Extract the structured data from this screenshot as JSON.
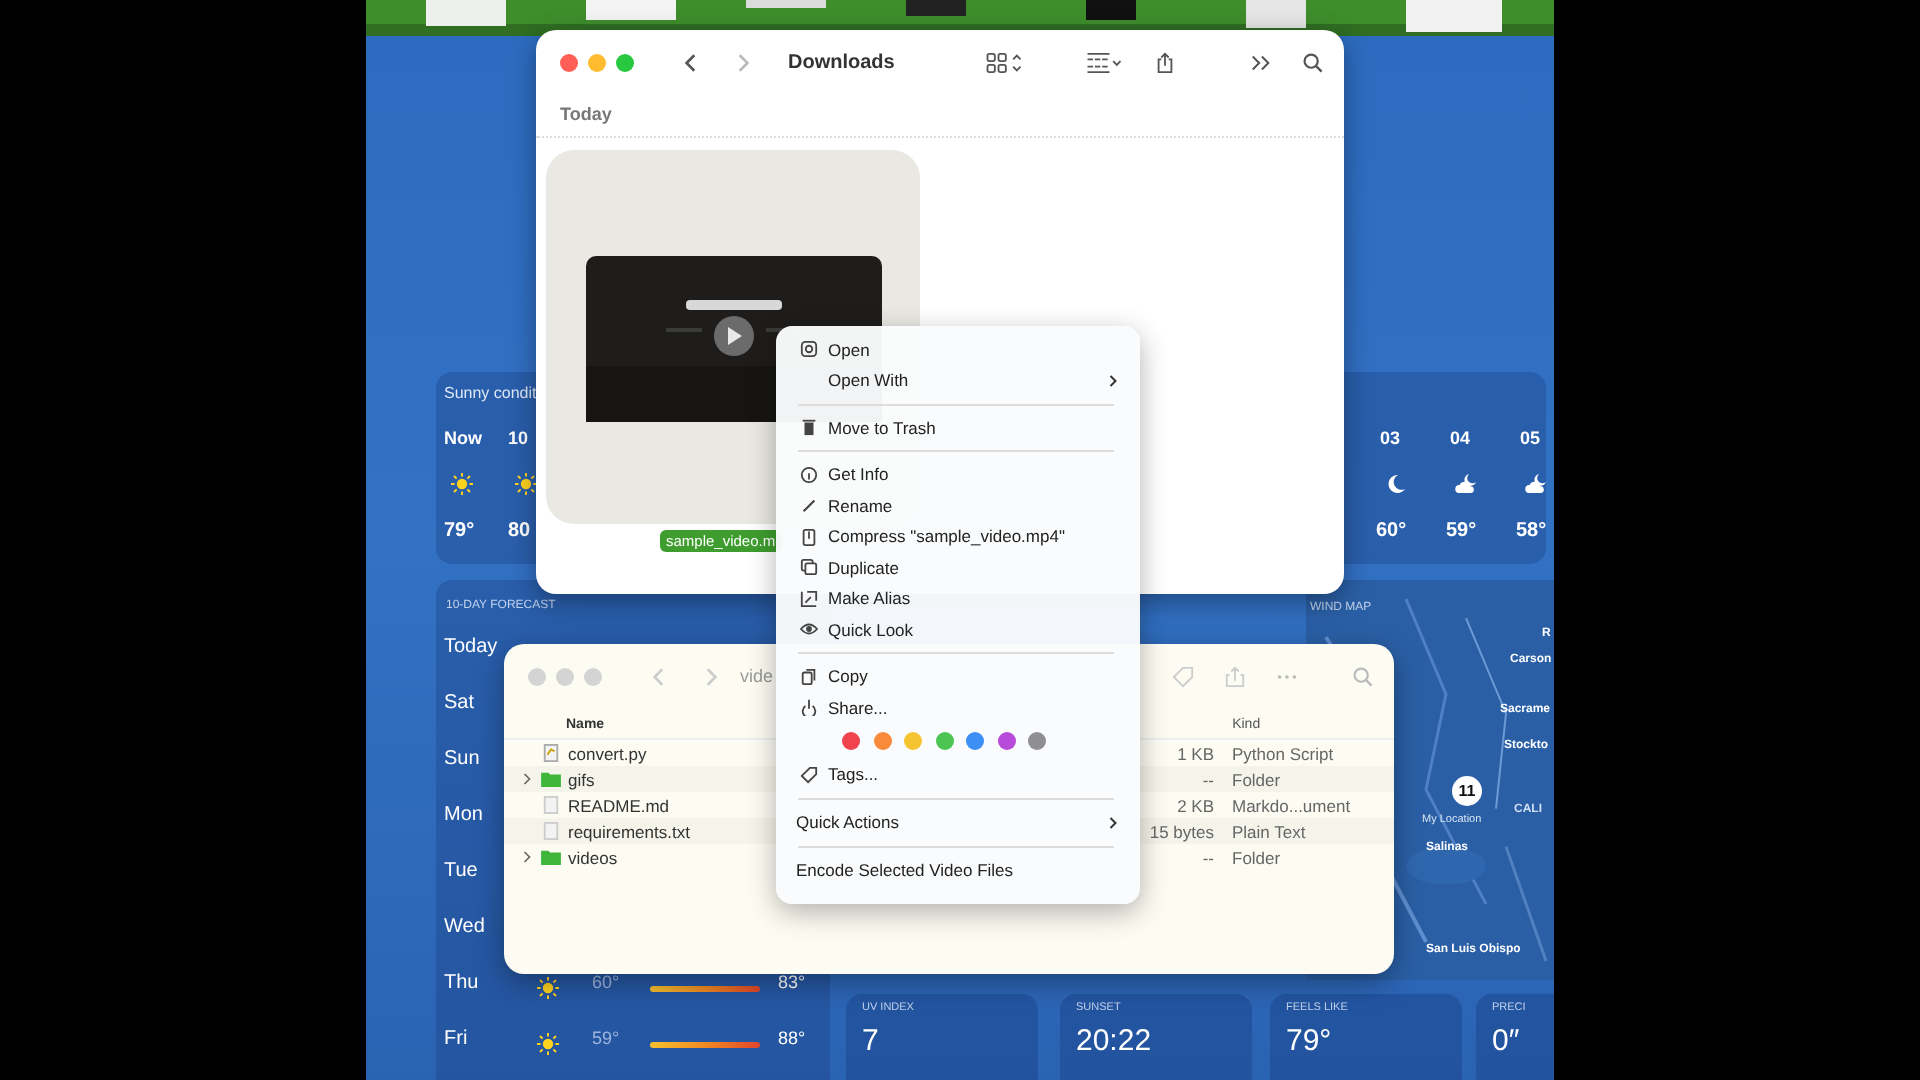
{
  "weather": {
    "summary": "Sunny condit",
    "hourly": [
      {
        "time": "Now",
        "kind": "sun",
        "temp": "79°"
      },
      {
        "time": "10",
        "kind": "sun",
        "temp": "80"
      }
    ],
    "hourly_late": [
      {
        "time": "03",
        "kind": "moon",
        "temp": "60°"
      },
      {
        "time": "04",
        "kind": "cloud-moon",
        "temp": "59°"
      },
      {
        "time": "05",
        "kind": "cloud-moon",
        "temp": "58°"
      }
    ],
    "forecast_title": "10-DAY FORECAST",
    "days": [
      {
        "day": "Today"
      },
      {
        "day": "Sat"
      },
      {
        "day": "Sun"
      },
      {
        "day": "Mon"
      },
      {
        "day": "Tue"
      },
      {
        "day": "Wed"
      },
      {
        "day": "Thu",
        "low": "60°",
        "high": "83°"
      },
      {
        "day": "Fri",
        "low": "59°",
        "high": "88°"
      }
    ],
    "map": {
      "title": "WIND MAP",
      "badge": "11",
      "badge_label": "My Location",
      "places": [
        {
          "name": "R",
          "kind": "edge"
        },
        {
          "name": "Carson",
          "kind": "city"
        },
        {
          "name": "Sacrame",
          "kind": "city"
        },
        {
          "name": "Stockto",
          "kind": "city"
        },
        {
          "name": "CALI",
          "kind": "region"
        },
        {
          "name": "Salinas",
          "kind": "city"
        },
        {
          "name": "San Luis Obispo",
          "kind": "city"
        }
      ]
    },
    "tiles": [
      {
        "kind": "uv",
        "label": "UV INDEX",
        "value": "7"
      },
      {
        "kind": "sunset",
        "label": "SUNSET",
        "value": "20:22"
      },
      {
        "kind": "feels",
        "label": "FEELS LIKE",
        "value": "79°"
      },
      {
        "kind": "precip",
        "label": "PRECI",
        "value": "0″"
      }
    ]
  },
  "downloads": {
    "title": "Downloads",
    "active": true,
    "section": "Today",
    "file": {
      "name": "sample_video.m",
      "selected": true
    }
  },
  "context_menu": [
    {
      "kind": "open",
      "label": "Open"
    },
    {
      "kind": "open-with",
      "label": "Open With"
    },
    {
      "kind": "separator"
    },
    {
      "kind": "trash",
      "label": "Move to Trash"
    },
    {
      "kind": "separator"
    },
    {
      "kind": "info",
      "label": "Get Info"
    },
    {
      "kind": "rename",
      "label": "Rename"
    },
    {
      "kind": "compress",
      "label": "Compress \"sample_video.mp4\""
    },
    {
      "kind": "duplicate",
      "label": "Duplicate"
    },
    {
      "kind": "alias",
      "label": "Make Alias"
    },
    {
      "kind": "quick-look",
      "label": "Quick Look"
    },
    {
      "kind": "separator"
    },
    {
      "kind": "copy",
      "label": "Copy"
    },
    {
      "kind": "share",
      "label": "Share..."
    },
    {
      "kind": "tag-colors",
      "colors": [
        {
          "color": "#f0434d"
        },
        {
          "color": "#f88a3a"
        },
        {
          "color": "#f5c531"
        },
        {
          "color": "#4cc552"
        },
        {
          "color": "#3b8ff5"
        },
        {
          "color": "#b74ad8"
        },
        {
          "color": "#8e8e93"
        }
      ]
    },
    {
      "kind": "tags",
      "label": "Tags..."
    },
    {
      "kind": "separator"
    },
    {
      "kind": "quick-actions",
      "label": "Quick Actions"
    },
    {
      "kind": "separator"
    },
    {
      "kind": "action",
      "label": "Encode Selected Video Files"
    }
  ],
  "videos_window": {
    "title": "vide",
    "active": false,
    "columns": [
      {
        "label": "Name"
      },
      {
        "label": "Kind"
      }
    ],
    "rows": [
      {
        "name": "convert.py",
        "size": "1 KB",
        "file_kind": "Python Script",
        "kind": "script"
      },
      {
        "name": "gifs",
        "size": "--",
        "file_kind": "Folder",
        "kind": "folder"
      },
      {
        "name": "README.md",
        "size": "2 KB",
        "file_kind": "Markdo...ument",
        "kind": "doc"
      },
      {
        "name": "requirements.txt",
        "size": "15 bytes",
        "file_kind": "Plain Text",
        "kind": "doc"
      },
      {
        "name": "videos",
        "size": "--",
        "file_kind": "Folder",
        "kind": "folder"
      }
    ]
  }
}
